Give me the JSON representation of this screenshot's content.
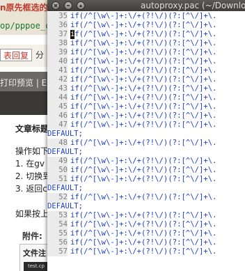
{
  "background_page": {
    "top_text": "n原先框选的",
    "url_text": "op/pppoe_c",
    "reply_buttons": [
      "表回复",
      "分"
    ],
    "print_bar": "打印预览 | En",
    "article_title": "文章标题",
    "body_lines": [
      "操作如下",
      "1. 在gv",
      "2. 切换到",
      "3. 返回c",
      "如果按上"
    ],
    "attachments_label": "附件:",
    "file_label": "文件注",
    "thumb_label": "test.cp"
  },
  "editor": {
    "title": "autoproxy.pac (~/Downloads",
    "window_buttons": [
      "close-icon",
      "minimize-icon",
      "maximize-icon"
    ],
    "colors": {
      "code": "#1a3ed0",
      "gutter": "#ebebeb",
      "line_number": "#7d7d7d"
    },
    "lines": [
      {
        "n": "35",
        "code": "if(/^[\\w\\-]+:\\/+(?!\\/)(?:[^\\/]+\\."
      },
      {
        "n": "36",
        "code": "if(/^[\\w\\-]+:\\/+(?!\\/)(?:[^\\/]+\\."
      },
      {
        "n": "37",
        "code": "if(/^[\\w\\-]+:\\/+(?!\\/)(?:[^\\/]+\\.",
        "cursor": true
      },
      {
        "n": "38",
        "code": "if(/^[\\w\\-]+:\\/+(?!\\/)(?:[^\\/]+\\."
      },
      {
        "n": "39",
        "code": "if(/^[\\w\\-]+:\\/+(?!\\/)(?:[^\\/]+\\."
      },
      {
        "n": "40",
        "code": "if(/^[\\w\\-]+:\\/+(?!\\/)(?:[^\\/]+\\."
      },
      {
        "n": "41",
        "code": "if(/^[\\w\\-]+:\\/+(?!\\/)(?:[^\\/]+\\."
      },
      {
        "n": "42",
        "code": "if(/^[\\w\\-]+:\\/+(?!\\/)(?:[^\\/]+\\."
      },
      {
        "n": "43",
        "code": "if(/^[\\w\\-]+:\\/+(?!\\/)(?:[^\\/]+\\."
      },
      {
        "n": "44",
        "code": "if(/^[\\w\\-]+:\\/+(?!\\/)(?:[^\\/]+\\."
      },
      {
        "n": "45",
        "code": "if(/^[\\w\\-]+:\\/+(?!\\/)(?:[^\\/]+\\."
      },
      {
        "n": "46",
        "code": "if(/^[\\w\\-]+:\\/+(?!\\/)(?:[^\\/]+\\."
      },
      {
        "n": "47",
        "code": "if(/^[\\w\\-]+:\\/+(?!\\/)(?:[^\\/]+\\.",
        "cont": "DEFAULT;"
      },
      {
        "n": "48",
        "code": "if(/^[\\w\\-]+:\\/+(?!\\/)(?:[^\\/]+\\.",
        "cont": "DEFAULT;"
      },
      {
        "n": "49",
        "code": "if(/^[\\w\\-]+:\\/+(?!\\/)(?:[^\\/]+\\."
      },
      {
        "n": "50",
        "code": "if(/^[\\w\\-]+:\\/+(?!\\/)(?:[^\\/]+\\."
      },
      {
        "n": "51",
        "code": "if(/^[\\w\\-]+:\\/+(?!\\/)(?:[^\\/]+\\.",
        "cont": "DEFAULT;"
      },
      {
        "n": "52",
        "code": "if(/^[\\w\\-]+:\\/+(?!\\/)(?:[^\\/]+\\.",
        "cont": "DEFAULT;"
      },
      {
        "n": "53",
        "code": "if(/^[\\w\\-]+:\\/+(?!\\/)(?:[^\\/]+\\."
      },
      {
        "n": "54",
        "code": "if(/^[\\w\\-]+:\\/+(?!\\/)(?:[^\\/]+\\."
      },
      {
        "n": "55",
        "code": "if(/^[\\w\\-]+:\\/+(?!\\/)(?:[^\\/]+\\."
      },
      {
        "n": "56",
        "code": "if(/^[\\w\\-]+:\\/+(?!\\/)(?:[^\\/]+\\."
      },
      {
        "n": "57",
        "code": "if(/^[\\w\\-]+:\\/+(?!\\/)(?:[^\\/]+\\."
      }
    ]
  }
}
